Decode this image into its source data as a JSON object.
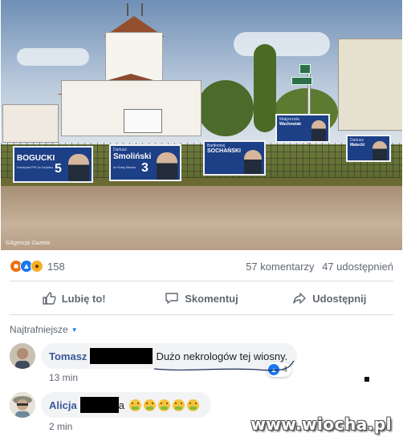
{
  "photo": {
    "watermark": "©Agencja Gazeta",
    "posters": [
      {
        "first_name": "",
        "last_name": "BOGUCKI",
        "subtitle": "Kandydat PiS do Sejmiku",
        "number": "5"
      },
      {
        "first_name": "Dariusz",
        "last_name": "Smoliński",
        "subtitle": "do Rady Miasta",
        "number": "3"
      },
      {
        "first_name": "Bartłomiej",
        "last_name": "SOCHAŃSKI",
        "subtitle": "",
        "number": ""
      },
      {
        "first_name": "Małgorzata",
        "last_name": "Wachowiak",
        "subtitle": "",
        "number": ""
      },
      {
        "first_name": "Dariusz",
        "last_name": "Matecki",
        "subtitle": "",
        "number": ""
      }
    ]
  },
  "stats": {
    "reaction_count": "158",
    "comments": "57 komentarzy",
    "shares": "47 udostępnień"
  },
  "actions": {
    "like": "Lubię to!",
    "comment": "Skomentuj",
    "share": "Udostępnij"
  },
  "comments_section": {
    "filter_label": "Najtrafniejsze",
    "items": [
      {
        "author": "Tomasz",
        "text": "Dużo nekrologów tej wiosny.",
        "time": "13 min",
        "likes": "4"
      },
      {
        "author": "Alicja",
        "text": "a",
        "time": "2 min",
        "likes": ""
      }
    ]
  },
  "watermark_site": "www.wiocha.pl",
  "colors": {
    "link": "#385898",
    "accent": "#1877f2",
    "muted": "#606770"
  }
}
